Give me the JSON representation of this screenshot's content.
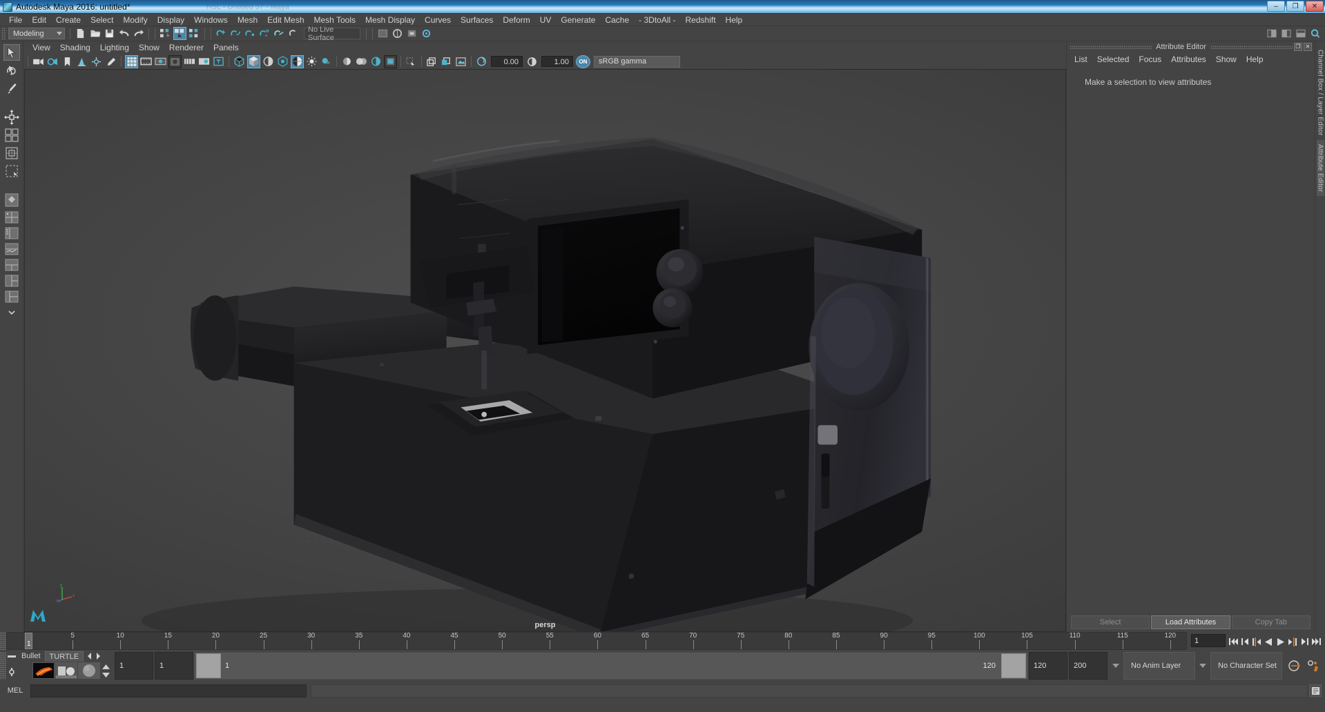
{
  "window": {
    "title": "Autodesk Maya 2016: untitled*",
    "ghost_title": "HSL - Untitled 37 - Maya",
    "app_icon": "maya-icon",
    "buttons": {
      "minimize": "–",
      "maximize": "❐",
      "close": "✕"
    }
  },
  "menubar": {
    "items": [
      "File",
      "Edit",
      "Create",
      "Select",
      "Modify",
      "Display",
      "Windows",
      "Mesh",
      "Edit Mesh",
      "Mesh Tools",
      "Mesh Display",
      "Curves",
      "Surfaces",
      "Deform",
      "UV",
      "Generate",
      "Cache",
      "- 3DtoAll -",
      "Redshift",
      "Help"
    ]
  },
  "statusline": {
    "menuset": "Modeling",
    "live_surface": "No Live Surface",
    "icons": [
      "new-scene-icon",
      "open-scene-icon",
      "save-scene-icon",
      "undo-icon",
      "redo-icon",
      "select-by-hierarchy-icon",
      "select-by-object-icon",
      "select-by-component-icon",
      "snap-to-grid-icon",
      "snap-to-curve-icon",
      "snap-to-point-icon",
      "snap-to-projected-center-icon",
      "snap-to-view-plane-icon",
      "make-live-icon",
      "render-view-icon",
      "render-icon",
      "ipr-render-icon",
      "render-settings-icon"
    ],
    "right_icons": [
      "toggle-channel-box-icon",
      "toggle-attribute-editor-icon",
      "toggle-tool-settings-icon",
      "help-search-icon"
    ]
  },
  "toolbox": {
    "tools": [
      {
        "name": "select-tool",
        "selected": true
      },
      {
        "name": "lasso-select-tool",
        "selected": false
      },
      {
        "name": "paint-select-tool",
        "selected": false
      },
      {
        "name": "move-tool",
        "selected": false
      },
      {
        "name": "rotate-tool",
        "selected": false
      },
      {
        "name": "scale-tool",
        "selected": false
      }
    ],
    "layouts": [
      {
        "name": "single-perspective-layout"
      },
      {
        "name": "four-view-layout"
      },
      {
        "name": "persp-outliner-layout"
      },
      {
        "name": "persp-graph-layout"
      },
      {
        "name": "two-pane-stacked-layout"
      },
      {
        "name": "two-pane-side-layout"
      },
      {
        "name": "three-pane-layout"
      },
      {
        "name": "more-layouts-icon"
      }
    ]
  },
  "viewport": {
    "menus": [
      "View",
      "Shading",
      "Lighting",
      "Show",
      "Renderer",
      "Panels"
    ],
    "camera_label": "persp",
    "toolbar": {
      "exposure_value": "0.00",
      "gamma_value": "1.00",
      "color_management_toggle": "ON",
      "view_transform": "sRGB gamma",
      "icons": [
        "select-camera-icon",
        "camera-attributes-icon",
        "bookmark-icon",
        "image-plane-icon",
        "two-sided-lighting-icon",
        "grid-icon",
        "film-gate-icon",
        "resolution-gate-icon",
        "gate-mask-icon",
        "field-chart-icon",
        "safe-action-icon",
        "safe-title-icon",
        "wireframe-icon",
        "smooth-shade-all-icon",
        "smooth-shade-selected-icon",
        "flat-shade-icon",
        "shaded-wireframe-icon",
        "textured-icon",
        "use-all-lights-icon",
        "shadows-icon",
        "ambient-occlusion-icon",
        "motion-blur-icon",
        "multisample-icon",
        "isolate-select-icon",
        "xray-icon",
        "xray-joints-icon",
        "xray-active-components-icon",
        "exposure-icon",
        "gamma-icon"
      ]
    }
  },
  "attribute_editor": {
    "panel_title": "Attribute Editor",
    "menus": [
      "List",
      "Selected",
      "Focus",
      "Attributes",
      "Show",
      "Help"
    ],
    "message": "Make a selection to view attributes",
    "buttons": [
      {
        "label": "Select",
        "active": false
      },
      {
        "label": "Load Attributes",
        "active": true
      },
      {
        "label": "Copy Tab",
        "active": false
      }
    ],
    "window_buttons": [
      "undock-icon",
      "close-icon"
    ],
    "side_tabs": [
      {
        "label": "Channel Box / Layer Editor",
        "selected": false
      },
      {
        "label": "Attribute Editor",
        "selected": true
      }
    ]
  },
  "timeslider": {
    "tick_labels": [
      "5",
      "10",
      "15",
      "20",
      "25",
      "30",
      "35",
      "40",
      "45",
      "50",
      "55",
      "60",
      "65",
      "70",
      "75",
      "80",
      "85",
      "90",
      "95",
      "100",
      "105",
      "110",
      "115",
      "120"
    ],
    "current_frame": "1",
    "current_frame_field": "1",
    "playback_buttons": [
      "go-to-start-icon",
      "step-back-frame-icon",
      "step-back-key-icon",
      "play-backwards-icon",
      "play-forwards-icon",
      "step-forward-key-icon",
      "step-forward-frame-icon",
      "go-to-end-icon"
    ]
  },
  "rangeslider": {
    "shelf_tabs": [
      "Bullet",
      "TURTLE"
    ],
    "shelf_tab_selected": "TURTLE",
    "shelf_nav": [
      "prev-shelf-icon",
      "next-shelf-icon"
    ],
    "shelf_icons": [
      "turtle-bake-icon",
      "turtle-render-icon",
      "turtle-material-icon"
    ],
    "anim_start": "1",
    "range_start": "1",
    "range_start_handle": "1",
    "range_end_handle": "120",
    "anim_end": "120",
    "playback_end": "200",
    "anim_layer": "No Anim Layer",
    "character_set": "No Character Set",
    "right_icons": [
      "auto-keyframe-icon",
      "animation-preferences-icon"
    ]
  },
  "command_line": {
    "label": "MEL",
    "input_value": "",
    "output_value": "",
    "script_editor_icon": "script-editor-icon"
  },
  "colors": {
    "accent_blue": "#4c86a8",
    "panel_bg": "#444444",
    "viewport_bg": "#434343",
    "field_bg": "#2b2b2b",
    "highlight": "#5c5c5c",
    "orange": "#d07a2a"
  }
}
